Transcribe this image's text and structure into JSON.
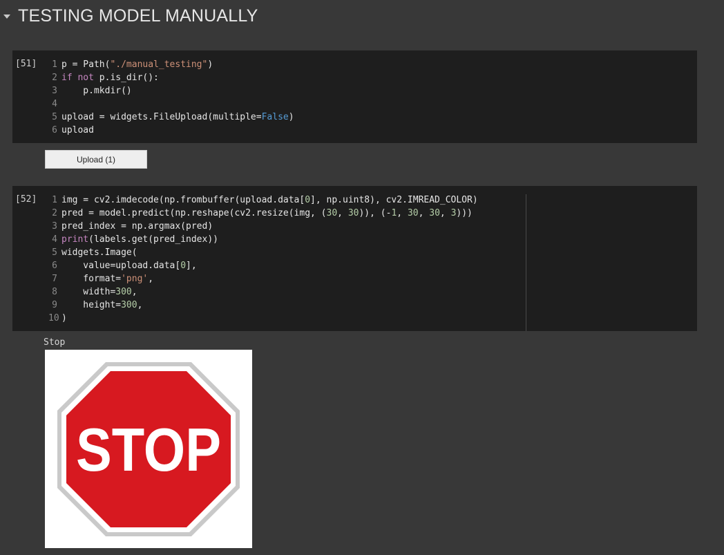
{
  "section": {
    "title": "TESTING MODEL MANUALLY",
    "caret_icon": "chevron-down-icon"
  },
  "cell1": {
    "prompt": "[51]",
    "lines": [
      "p = Path(\"./manual_testing\")",
      "if not p.is_dir():",
      "    p.mkdir()",
      "",
      "upload = widgets.FileUpload(multiple=False)",
      "upload"
    ]
  },
  "upload_widget": {
    "label": "Upload (1)"
  },
  "cell2": {
    "prompt": "[52]",
    "lines": [
      "img = cv2.imdecode(np.frombuffer(upload.data[0], np.uint8), cv2.IMREAD_COLOR)",
      "pred = model.predict(np.reshape(cv2.resize(img, (30, 30)), (-1, 30, 30, 3)))",
      "pred_index = np.argmax(pred)",
      "print(labels.get(pred_index))",
      "widgets.Image(",
      "    value=upload.data[0],",
      "    format='png',",
      "    width=300,",
      "    height=300,",
      ")"
    ]
  },
  "output": {
    "text": "Stop",
    "image": {
      "icon": "stop-sign-icon",
      "sign_text": "STOP",
      "colors": {
        "sign_red": "#d71920",
        "sign_border": "#ffffff",
        "background": "#ffffff"
      }
    }
  },
  "colors": {
    "page_bg": "#383838",
    "cell_bg": "#1e1e1e",
    "keyword": "#c586c0",
    "boolean": "#569cd6",
    "string": "#ce9178",
    "number": "#b5cea8"
  }
}
